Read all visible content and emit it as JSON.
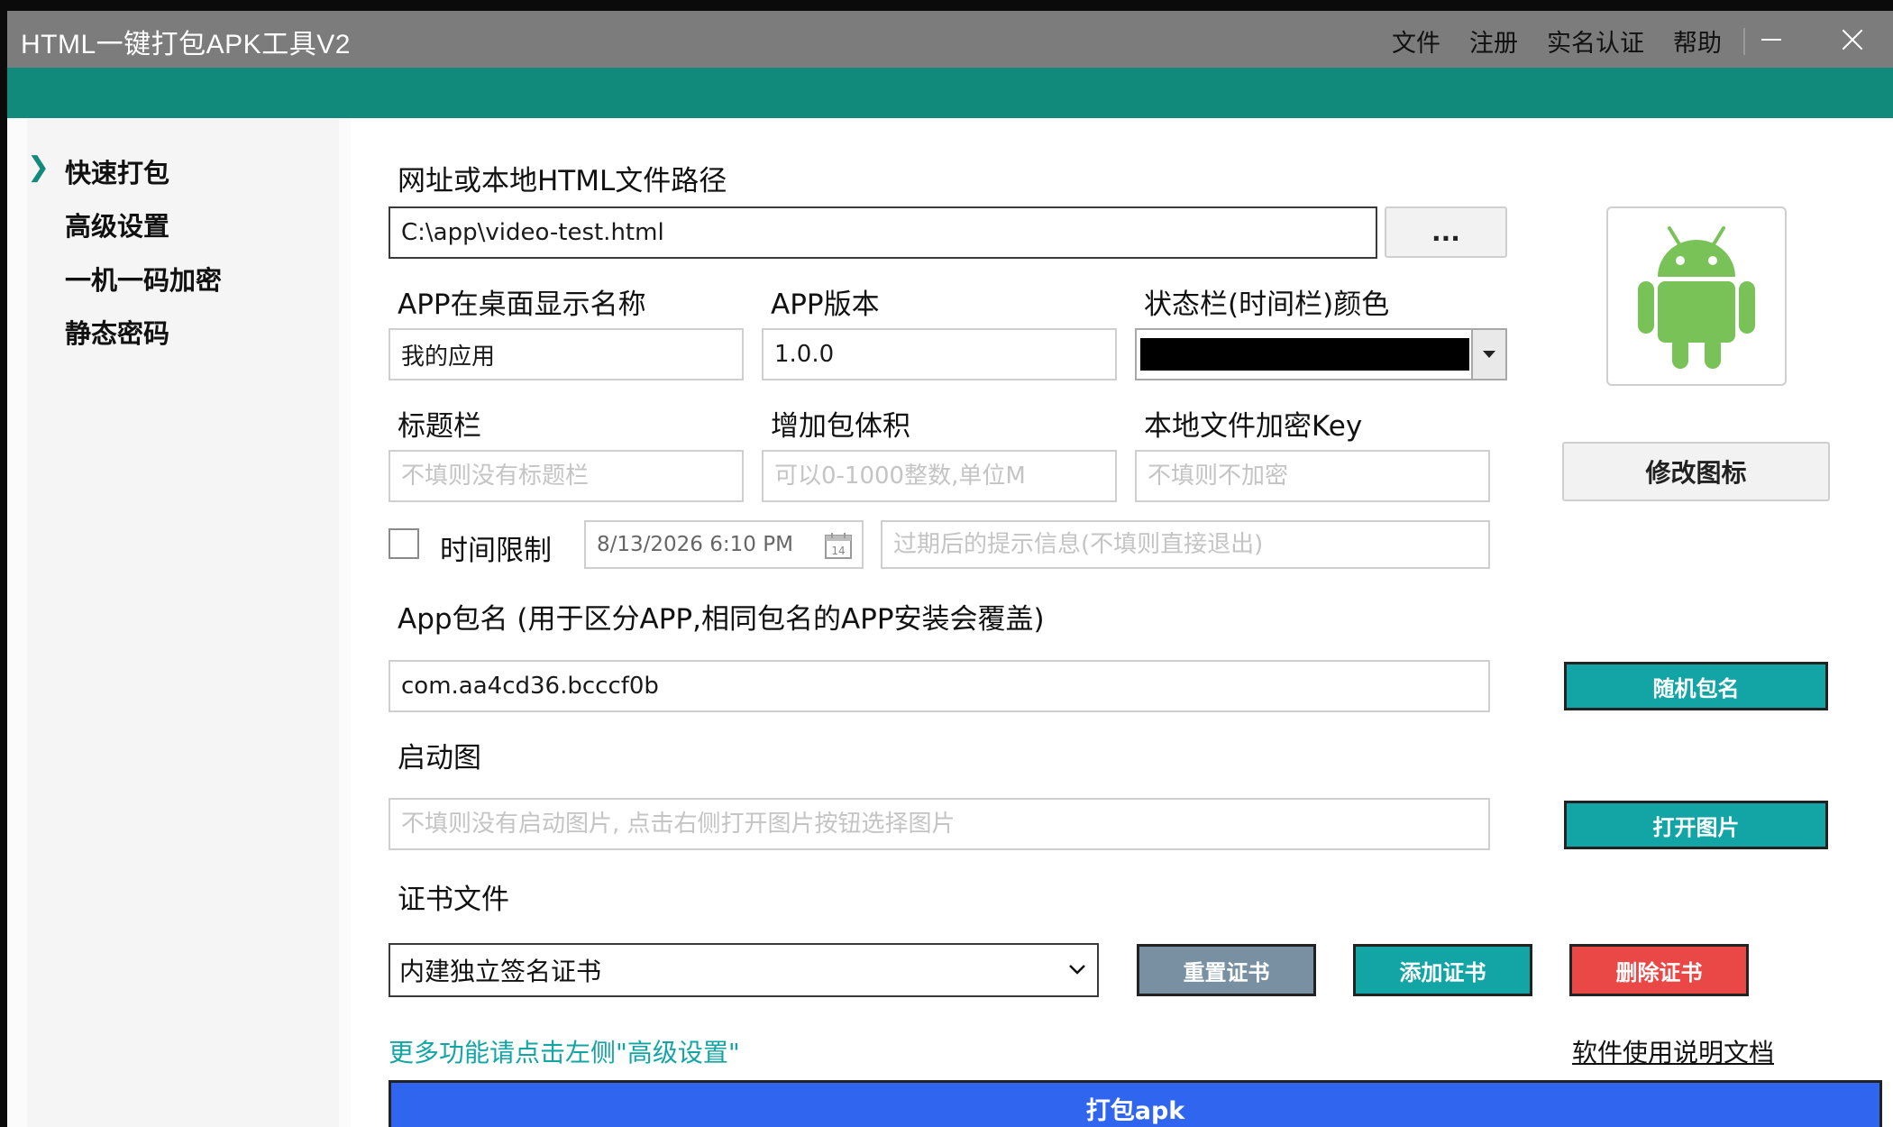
{
  "window": {
    "title": "HTML一键打包APK工具V2",
    "menu": [
      "文件",
      "注册",
      "实名认证",
      "帮助"
    ],
    "accent_color": "#128a7b"
  },
  "sidebar": {
    "items": [
      {
        "label": "快速打包",
        "active": true
      },
      {
        "label": "高级设置",
        "active": false
      },
      {
        "label": "一机一码加密",
        "active": false
      },
      {
        "label": "静态密码",
        "active": false
      }
    ]
  },
  "form": {
    "url": {
      "label": "网址或本地HTML文件路径",
      "value": "C:\\app\\video-test.html",
      "browse_label": "..."
    },
    "app_name": {
      "label": "APP在桌面显示名称",
      "value": "我的应用"
    },
    "app_version": {
      "label": "APP版本",
      "value": "1.0.0"
    },
    "status_bar_color": {
      "label": "状态栏(时间栏)颜色",
      "value_color": "#000000"
    },
    "title_bar": {
      "label": "标题栏",
      "placeholder": "不填则没有标题栏"
    },
    "pad_size": {
      "label": "增加包体积",
      "placeholder": "可以0-1000整数,单位M"
    },
    "encrypt_key": {
      "label": "本地文件加密Key",
      "placeholder": "不填则不加密"
    },
    "time_limit": {
      "label": "时间限制",
      "checked": false,
      "date": "8/13/2026 6:10 PM",
      "calendar_day": "14",
      "message_placeholder": "过期后的提示信息(不填则直接退出)"
    },
    "package_name": {
      "label": "App包名 (用于区分APP,相同包名的APP安装会覆盖)",
      "value": "com.aa4cd36.bcccf0b"
    },
    "splash": {
      "label": "启动图",
      "placeholder": "不填则没有启动图片, 点击右侧打开图片按钮选择图片"
    },
    "certificate": {
      "label": "证书文件",
      "selected": "内建独立签名证书"
    }
  },
  "icon_panel": {
    "icon_name": "android-robot-icon",
    "icon_color": "#78c257",
    "change_icon_label": "修改图标"
  },
  "buttons": {
    "random_package": "随机包名",
    "open_image": "打开图片",
    "reset_cert": "重置证书",
    "add_cert": "添加证书",
    "delete_cert": "删除证书",
    "build": "打包apk"
  },
  "footer": {
    "hint_link": "更多功能请点击左侧\"高级设置\"",
    "docs_link": "软件使用说明文档",
    "hint_color": "#13a5a5"
  }
}
